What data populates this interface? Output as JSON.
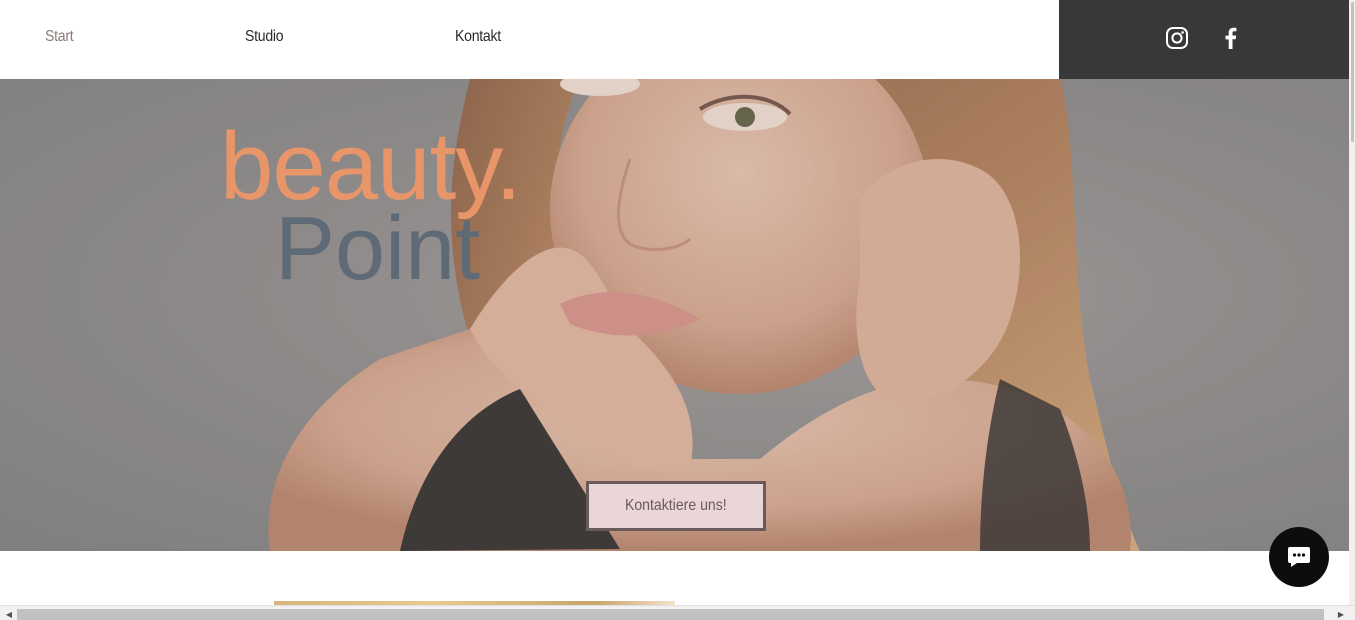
{
  "nav": {
    "items": [
      {
        "label": "Start",
        "active": true
      },
      {
        "label": "Studio",
        "active": false
      },
      {
        "label": "Kontakt",
        "active": false
      }
    ]
  },
  "social": {
    "icons": [
      "instagram-icon",
      "facebook-icon"
    ],
    "bar_color": "#383838"
  },
  "hero": {
    "logo_word1": "beauty.",
    "logo_word2": "Point",
    "cta_label": "Kontaktiere uns!"
  },
  "colors": {
    "logo_accent": "#e8956a",
    "logo_secondary": "#5e6a76",
    "cta_bg": "#ead6d8",
    "chat_button": "#0d0d0d"
  },
  "scroll": {
    "left_arrow": "◀",
    "right_arrow": "▶"
  }
}
